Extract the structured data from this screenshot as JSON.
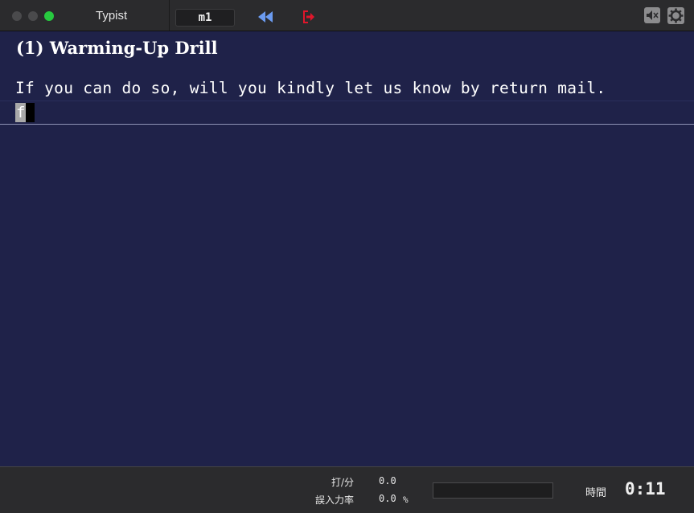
{
  "window": {
    "app_title": "Typist",
    "mode": "m1"
  },
  "toolbar": {
    "rewind_icon": "rewind-icon",
    "exit_icon": "exit-icon",
    "mute_icon": "speaker-mute-icon",
    "settings_icon": "gear-icon"
  },
  "drill": {
    "title": "(1) Warming-Up Drill",
    "prompt": "If you can do so, will you kindly let us know by return mail.",
    "typed": "f"
  },
  "stats": {
    "speed_label": "打/分",
    "speed_value": "0.0",
    "error_label": "誤入力率",
    "error_value": "0.0",
    "error_unit": "%",
    "progress": 0,
    "time_label": "時間",
    "time_value": "0:11"
  },
  "colors": {
    "background": "#1f2249",
    "rewind": "#6b9bf0",
    "exit": "#e0162b",
    "maximize": "#27c93f"
  }
}
